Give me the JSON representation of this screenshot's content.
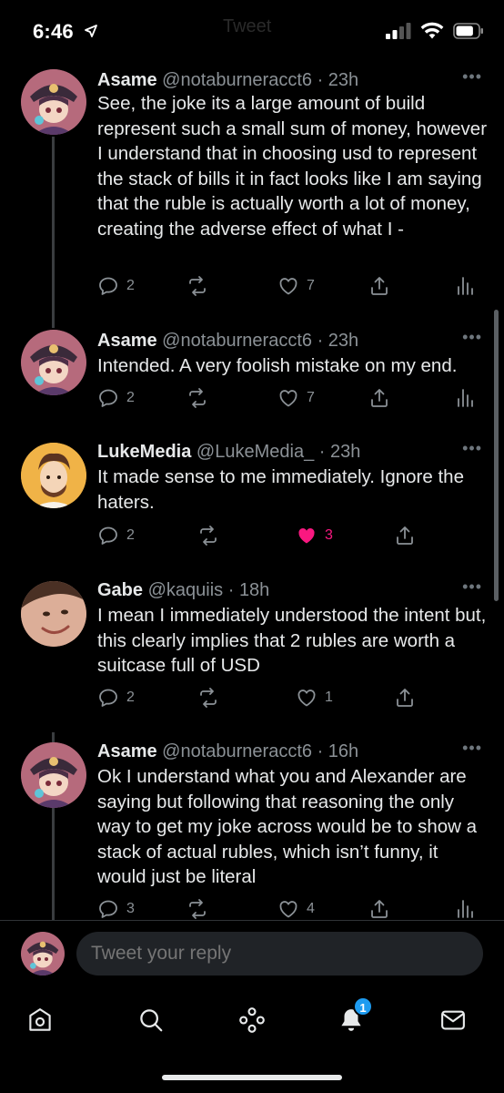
{
  "status": {
    "time": "6:46",
    "battery_level": 0.8,
    "ghost_title": "Tweet"
  },
  "thread": [
    {
      "name": "Asame",
      "handle": "@notaburneracct6",
      "time": "23h",
      "text": "See, the joke its a large amount of build represent such a small sum of money, however I understand that in choosing usd to represent the stack of bills it in fact looks like I am saying that the ruble is actually worth a lot of money, creating the adverse effect of what I -",
      "replies": "2",
      "retweets": "",
      "likes": "7",
      "liked": false,
      "avatar": "anime-avatar"
    },
    {
      "name": "Asame",
      "handle": "@notaburneracct6",
      "time": "23h",
      "text": "Intended. A very foolish mistake on my end.",
      "replies": "2",
      "retweets": "",
      "likes": "7",
      "liked": false,
      "avatar": "anime-avatar"
    },
    {
      "name": "LukeMedia",
      "handle": "@LukeMedia_",
      "time": "23h",
      "text": "It made sense to me immediately. Ignore the haters.",
      "replies": "2",
      "retweets": "",
      "likes": "3",
      "liked": true,
      "avatar": "cartoon-avatar"
    },
    {
      "name": "Gabe",
      "handle": "@kaquiis",
      "time": "18h",
      "text": "I mean I immediately understood the intent but, this clearly implies that 2 rubles are worth a suitcase full of USD",
      "replies": "2",
      "retweets": "",
      "likes": "1",
      "liked": false,
      "avatar": "photo-avatar"
    },
    {
      "name": "Asame",
      "handle": "@notaburneracct6",
      "time": "16h",
      "text": "Ok I understand what you and Alexander are saying but following that reasoning the only way to get my joke across would be to show a stack of actual rubles, which isn’t funny, it would just be literal",
      "replies": "3",
      "retweets": "",
      "likes": "4",
      "liked": false,
      "avatar": "anime-avatar"
    }
  ],
  "reply": {
    "placeholder": "Tweet your reply"
  },
  "tabs": [
    {
      "name": "home",
      "icon": "home-icon"
    },
    {
      "name": "search",
      "icon": "search-icon"
    },
    {
      "name": "spaces",
      "icon": "spaces-icon"
    },
    {
      "name": "notifications",
      "icon": "bell-icon",
      "badge": "1"
    },
    {
      "name": "messages",
      "icon": "mail-icon"
    }
  ],
  "colors": {
    "background": "#000000",
    "text": "#e7e9ea",
    "muted": "#8b9196",
    "like": "#f91880",
    "accent": "#1d9bf0"
  }
}
